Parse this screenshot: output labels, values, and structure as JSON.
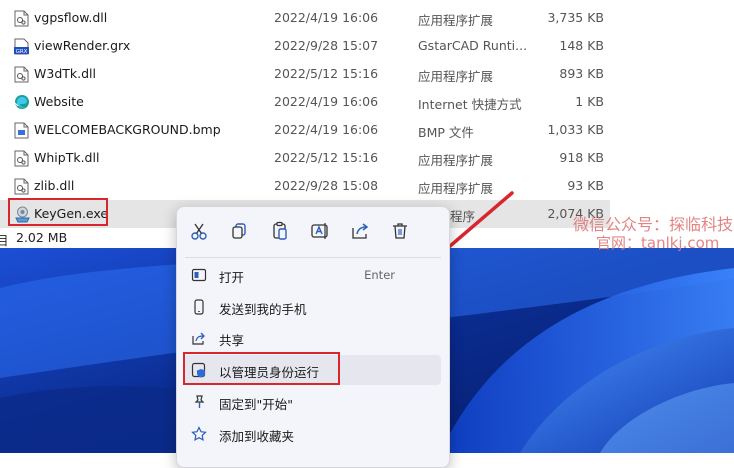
{
  "files": [
    {
      "name": "vgpsflow.dll",
      "date": "2022/4/19 16:06",
      "type": "应用程序扩展",
      "size": "3,735 KB",
      "icon": "dll-file-icon"
    },
    {
      "name": "viewRender.grx",
      "date": "2022/9/28 15:07",
      "type": "GstarCAD Runti...",
      "size": "148 KB",
      "icon": "grx-file-icon",
      "badge": "GRX"
    },
    {
      "name": "W3dTk.dll",
      "date": "2022/5/12 15:16",
      "type": "应用程序扩展",
      "size": "893 KB",
      "icon": "dll-file-icon"
    },
    {
      "name": "Website",
      "date": "2022/4/19 16:06",
      "type": "Internet 快捷方式",
      "size": "1 KB",
      "icon": "edge-shortcut-icon"
    },
    {
      "name": "WELCOMEBACKGROUND.bmp",
      "date": "2022/4/19 16:06",
      "type": "BMP 文件",
      "size": "1,033 KB",
      "icon": "bmp-file-icon"
    },
    {
      "name": "WhipTk.dll",
      "date": "2022/5/12 15:16",
      "type": "应用程序扩展",
      "size": "918 KB",
      "icon": "dll-file-icon"
    },
    {
      "name": "zlib.dll",
      "date": "2022/9/28 15:08",
      "type": "应用程序扩展",
      "size": "93 KB",
      "icon": "dll-file-icon"
    },
    {
      "name": "KeyGen.exe",
      "date": "",
      "type": "程序",
      "size": "2,074 KB",
      "icon": "exe-installer-icon",
      "selected": true
    }
  ],
  "status": {
    "text": "2.02 MB"
  },
  "watermark": {
    "line1": "微信公众号：探临科技",
    "line2": "官网：tanlkj.com"
  },
  "context_menu": {
    "quick_actions": [
      "cut-icon",
      "copy-icon",
      "paste-icon",
      "rename-icon",
      "share-icon",
      "delete-icon"
    ],
    "items": [
      {
        "label": "打开",
        "shortcut": "Enter",
        "icon": "open-window-icon"
      },
      {
        "label": "发送到我的手机",
        "icon": "phone-icon"
      },
      {
        "label": "共享",
        "icon": "share-icon"
      },
      {
        "label": "以管理员身份运行",
        "icon": "admin-shield-icon",
        "highlighted": true
      },
      {
        "label": "固定到\"开始\"",
        "icon": "pin-icon"
      },
      {
        "label": "添加到收藏夹",
        "icon": "star-icon"
      }
    ]
  },
  "colors": {
    "annotation_red": "#d8262e",
    "desktop_blue": "#0d2e8a",
    "menu_bg": "#f4f5fa",
    "selection": "#e5e5e5",
    "watermark": "#e07a7a"
  }
}
